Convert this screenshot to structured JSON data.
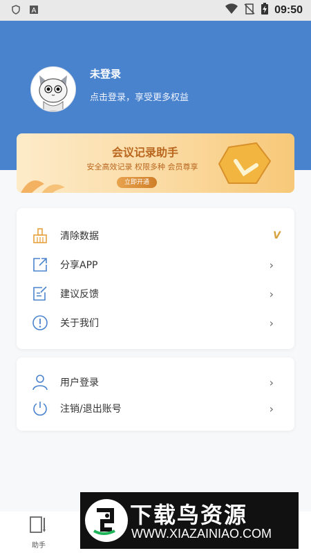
{
  "statusbar": {
    "time": "09:50",
    "notification_icons": [
      "shield-icon",
      "font-a-icon"
    ],
    "system_icons": [
      "wifi-icon",
      "no-sim-icon",
      "battery-charging-icon"
    ]
  },
  "profile": {
    "name": "未登录",
    "subtitle": "点击登录，享受更多权益"
  },
  "vip_banner": {
    "title": "会议记录助手",
    "subtitle": "安全高效记录 权限多种 会员尊享",
    "button": "立即开通"
  },
  "menu_main": [
    {
      "label": "清除数据",
      "icon": "broom-icon",
      "trailing": "vip-badge",
      "trailing_text": "V"
    },
    {
      "label": "分享APP",
      "icon": "share-icon",
      "trailing": "chevron-right-icon",
      "trailing_text": "›"
    },
    {
      "label": "建议反馈",
      "icon": "feedback-icon",
      "trailing": "chevron-right-icon",
      "trailing_text": "›"
    },
    {
      "label": "关于我们",
      "icon": "info-icon",
      "trailing": "chevron-right-icon",
      "trailing_text": "›"
    }
  ],
  "menu_account": [
    {
      "label": "用户登录",
      "icon": "user-icon",
      "trailing_text": "›"
    },
    {
      "label": "注销/退出账号",
      "icon": "power-icon",
      "trailing_text": "›"
    }
  ],
  "tabbar": {
    "tabs": [
      {
        "label": "助手",
        "icon": "notebook-icon"
      }
    ]
  },
  "watermark": {
    "title": "下载鸟资源",
    "url": "WWW.XIAZAINIAO.COM"
  },
  "colors": {
    "header_blue": "#4a83cd",
    "accent_orange": "#d7a13b",
    "icon_blue": "#4a83cd"
  }
}
